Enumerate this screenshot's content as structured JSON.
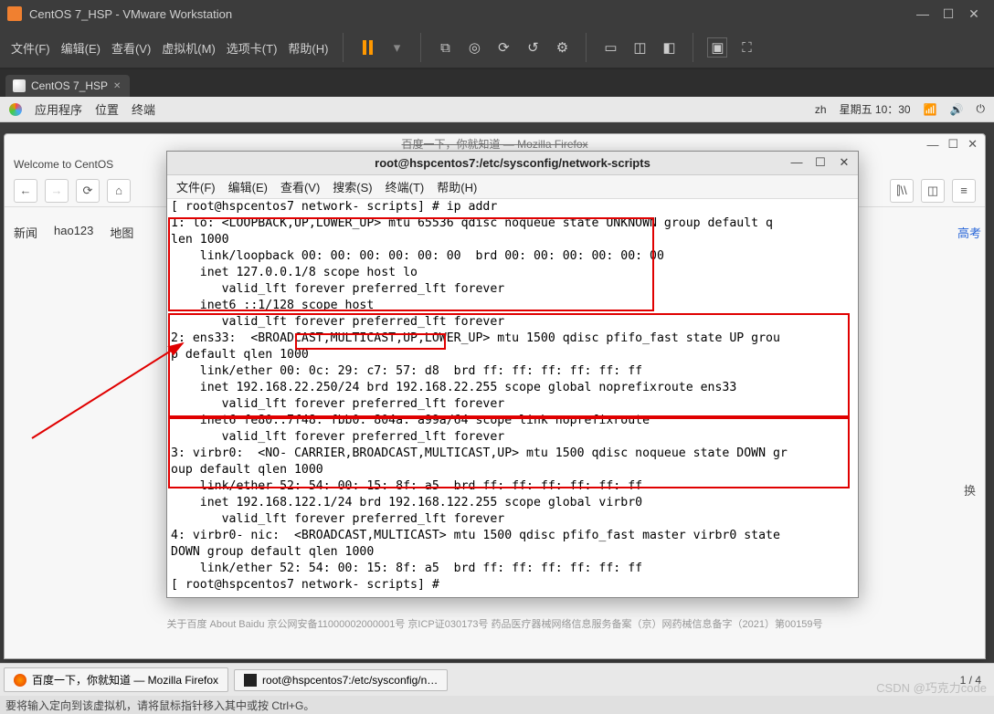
{
  "vmware": {
    "title": "CentOS 7_HSP - VMware Workstation",
    "win_min": "—",
    "win_max": "☐",
    "win_close": "✕",
    "menu": {
      "file": "文件(F)",
      "edit": "编辑(E)",
      "view": "查看(V)",
      "vm": "虚拟机(M)",
      "tabs": "选项卡(T)",
      "help": "帮助(H)"
    },
    "tab": {
      "label": "CentOS 7_HSP",
      "close": "✕"
    },
    "status": "要将输入定向到该虚拟机，请将鼠标指针移入其中或按 Ctrl+G。"
  },
  "centos_panel": {
    "apps": "应用程序",
    "places": "位置",
    "terminal": "终端",
    "lang": "zh",
    "date": "星期五 10：30"
  },
  "browser": {
    "title_hint": "百度一下，你就知道 — Mozilla Firefox",
    "tabtitle": "Welcome to CentOS",
    "win_min": "—",
    "win_max": "☐",
    "win_close": "✕",
    "nav_back": "←",
    "nav_fwd": "→",
    "nav_reload": "⟳",
    "nav_home": "⌂",
    "tbar_library": "⫿\\\\",
    "tbar_panel": "◫",
    "tbar_menu": "≡",
    "links": {
      "news": "新闻",
      "hao123": "hao123",
      "map": "地图",
      "gaokao": "高考",
      "huan": "换"
    },
    "footer": "关于百度   About Baidu   京公网安备11000002000001号   京ICP证030173号   药品医疗器械网络信息服务备案（京）网药械信息备字（2021）第00159号"
  },
  "terminal": {
    "title": "root@hspcentos7:/etc/sysconfig/network-scripts",
    "win_min": "—",
    "win_max": "☐",
    "win_close": "✕",
    "menu": {
      "file": "文件(F)",
      "edit": "编辑(E)",
      "view": "查看(V)",
      "search": "搜索(S)",
      "terminal": "终端(T)",
      "help": "帮助(H)"
    },
    "lines": "[ root@hspcentos7 network- scripts] # ip addr\n1: lo: <LOOPBACK,UP,LOWER_UP> mtu 65536 qdisc noqueue state UNKNOWN group default q\nlen 1000\n    link/loopback 00: 00: 00: 00: 00: 00  brd 00: 00: 00: 00: 00: 00\n    inet 127.0.0.1/8 scope host lo\n       valid_lft forever preferred_lft forever\n    inet6 ::1/128 scope host\n       valid_lft forever preferred_lft forever\n2: ens33:  <BROADCAST,MULTICAST,UP,LOWER_UP> mtu 1500 qdisc pfifo_fast state UP grou\np default qlen 1000\n    link/ether 00: 0c: 29: c7: 57: d8  brd ff: ff: ff: ff: ff: ff\n    inet 192.168.22.250/24 brd 192.168.22.255 scope global noprefixroute ens33\n       valid_lft forever preferred_lft forever\n    inet6 fe80::7f48: fbb0: 804a: a99a/64 scope link noprefixroute\n       valid_lft forever preferred_lft forever\n3: virbr0:  <NO- CARRIER,BROADCAST,MULTICAST,UP> mtu 1500 qdisc noqueue state DOWN gr\noup default qlen 1000\n    link/ether 52: 54: 00: 15: 8f: a5  brd ff: ff: ff: ff: ff: ff\n    inet 192.168.122.1/24 brd 192.168.122.255 scope global virbr0\n       valid_lft forever preferred_lft forever\n4: virbr0- nic:  <BROADCAST,MULTICAST> mtu 1500 qdisc pfifo_fast master virbr0 state \nDOWN group default qlen 1000\n    link/ether 52: 54: 00: 15: 8f: a5  brd ff: ff: ff: ff: ff: ff\n[ root@hspcentos7 network- scripts] # "
  },
  "taskbar": {
    "ff": "百度一下，你就知道 — Mozilla Firefox",
    "term": "root@hspcentos7:/etc/sysconfig/n…",
    "page": "1 / 4"
  },
  "watermark": "CSDN @巧克力code"
}
